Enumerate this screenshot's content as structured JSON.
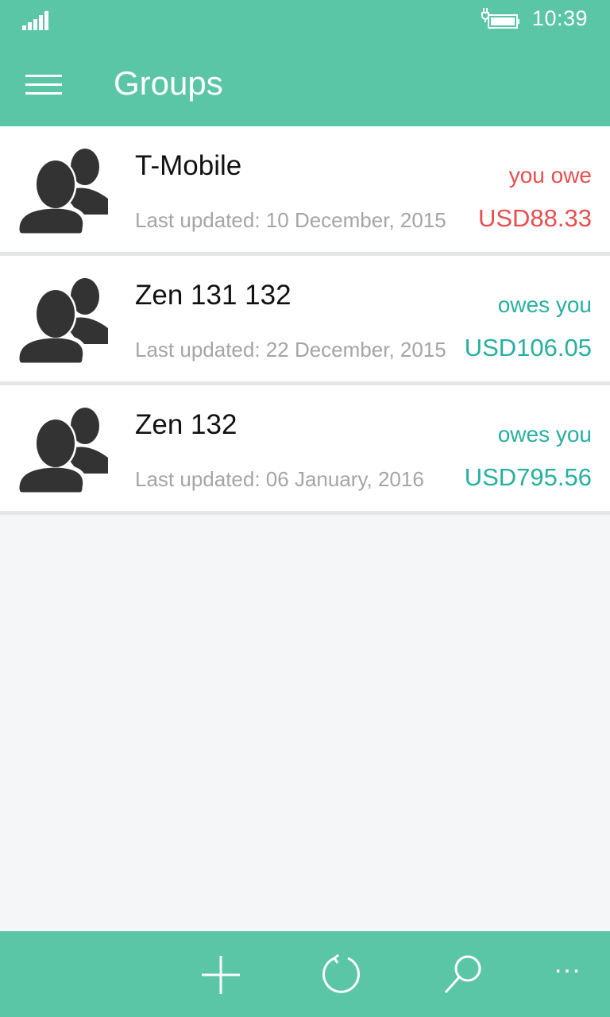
{
  "status_bar": {
    "time": "10:39"
  },
  "header": {
    "title": "Groups",
    "menu_icon": "hamburger-icon"
  },
  "groups": [
    {
      "name": "T-Mobile",
      "last_updated": "Last updated: 10 December, 2015",
      "balance_label": "you owe",
      "amount": "USD88.33",
      "color": "#e5504f"
    },
    {
      "name": "Zen 131 132",
      "last_updated": "Last updated: 22 December, 2015",
      "balance_label": "owes you",
      "amount": "USD106.05",
      "color": "#27b09e"
    },
    {
      "name": "Zen 132",
      "last_updated": "Last updated: 06 January, 2016",
      "balance_label": "owes you",
      "amount": "USD795.56",
      "color": "#27b09e"
    }
  ],
  "app_bar": {
    "buttons": [
      "add-icon",
      "refresh-icon",
      "search-icon"
    ],
    "more": "..."
  },
  "colors": {
    "accent": "#5bc6a5",
    "owe": "#e5504f",
    "owed": "#27b09e"
  }
}
